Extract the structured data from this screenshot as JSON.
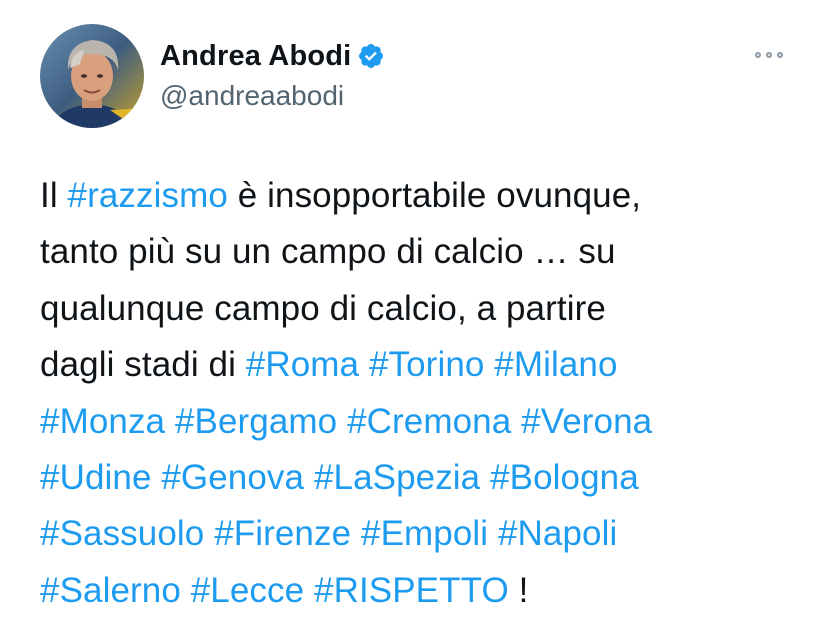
{
  "author": {
    "display_name": "Andrea Abodi",
    "handle": "@andreaabodi",
    "verified": true
  },
  "icons": {
    "verified": "verified-badge-icon",
    "more": "more-dots-icon"
  },
  "colors": {
    "hashtag": "#1d9bf0",
    "text": "#0f1419",
    "handle": "#536471",
    "verified_badge": "#1d9bf0"
  },
  "tweet": {
    "lines": [
      [
        {
          "text": "Il ",
          "type": "text"
        },
        {
          "text": "#razzismo",
          "type": "hashtag"
        },
        {
          "text": " è insopportabile ovunque,",
          "type": "text"
        }
      ],
      [
        {
          "text": "tanto più su un campo di calcio … su",
          "type": "text"
        }
      ],
      [
        {
          "text": "qualunque campo di calcio, a partire",
          "type": "text"
        }
      ],
      [
        {
          "text": "dagli stadi di ",
          "type": "text"
        },
        {
          "text": "#Roma",
          "type": "hashtag"
        },
        {
          "text": " ",
          "type": "text"
        },
        {
          "text": "#Torino",
          "type": "hashtag"
        },
        {
          "text": " ",
          "type": "text"
        },
        {
          "text": "#Milano",
          "type": "hashtag"
        }
      ],
      [
        {
          "text": "#Monza",
          "type": "hashtag"
        },
        {
          "text": " ",
          "type": "text"
        },
        {
          "text": "#Bergamo",
          "type": "hashtag"
        },
        {
          "text": " ",
          "type": "text"
        },
        {
          "text": "#Cremona",
          "type": "hashtag"
        },
        {
          "text": " ",
          "type": "text"
        },
        {
          "text": "#Verona",
          "type": "hashtag"
        }
      ],
      [
        {
          "text": "#Udine",
          "type": "hashtag"
        },
        {
          "text": " ",
          "type": "text"
        },
        {
          "text": "#Genova",
          "type": "hashtag"
        },
        {
          "text": " ",
          "type": "text"
        },
        {
          "text": "#LaSpezia",
          "type": "hashtag"
        },
        {
          "text": " ",
          "type": "text"
        },
        {
          "text": "#Bologna",
          "type": "hashtag"
        }
      ],
      [
        {
          "text": "#Sassuolo",
          "type": "hashtag"
        },
        {
          "text": " ",
          "type": "text"
        },
        {
          "text": "#Firenze",
          "type": "hashtag"
        },
        {
          "text": " ",
          "type": "text"
        },
        {
          "text": "#Empoli",
          "type": "hashtag"
        },
        {
          "text": " ",
          "type": "text"
        },
        {
          "text": "#Napoli",
          "type": "hashtag"
        }
      ],
      [
        {
          "text": "#Salerno",
          "type": "hashtag"
        },
        {
          "text": " ",
          "type": "text"
        },
        {
          "text": "#Lecce",
          "type": "hashtag"
        },
        {
          "text": " ",
          "type": "text"
        },
        {
          "text": "#RISPETTO",
          "type": "hashtag"
        },
        {
          "text": " !",
          "type": "text"
        }
      ]
    ]
  }
}
